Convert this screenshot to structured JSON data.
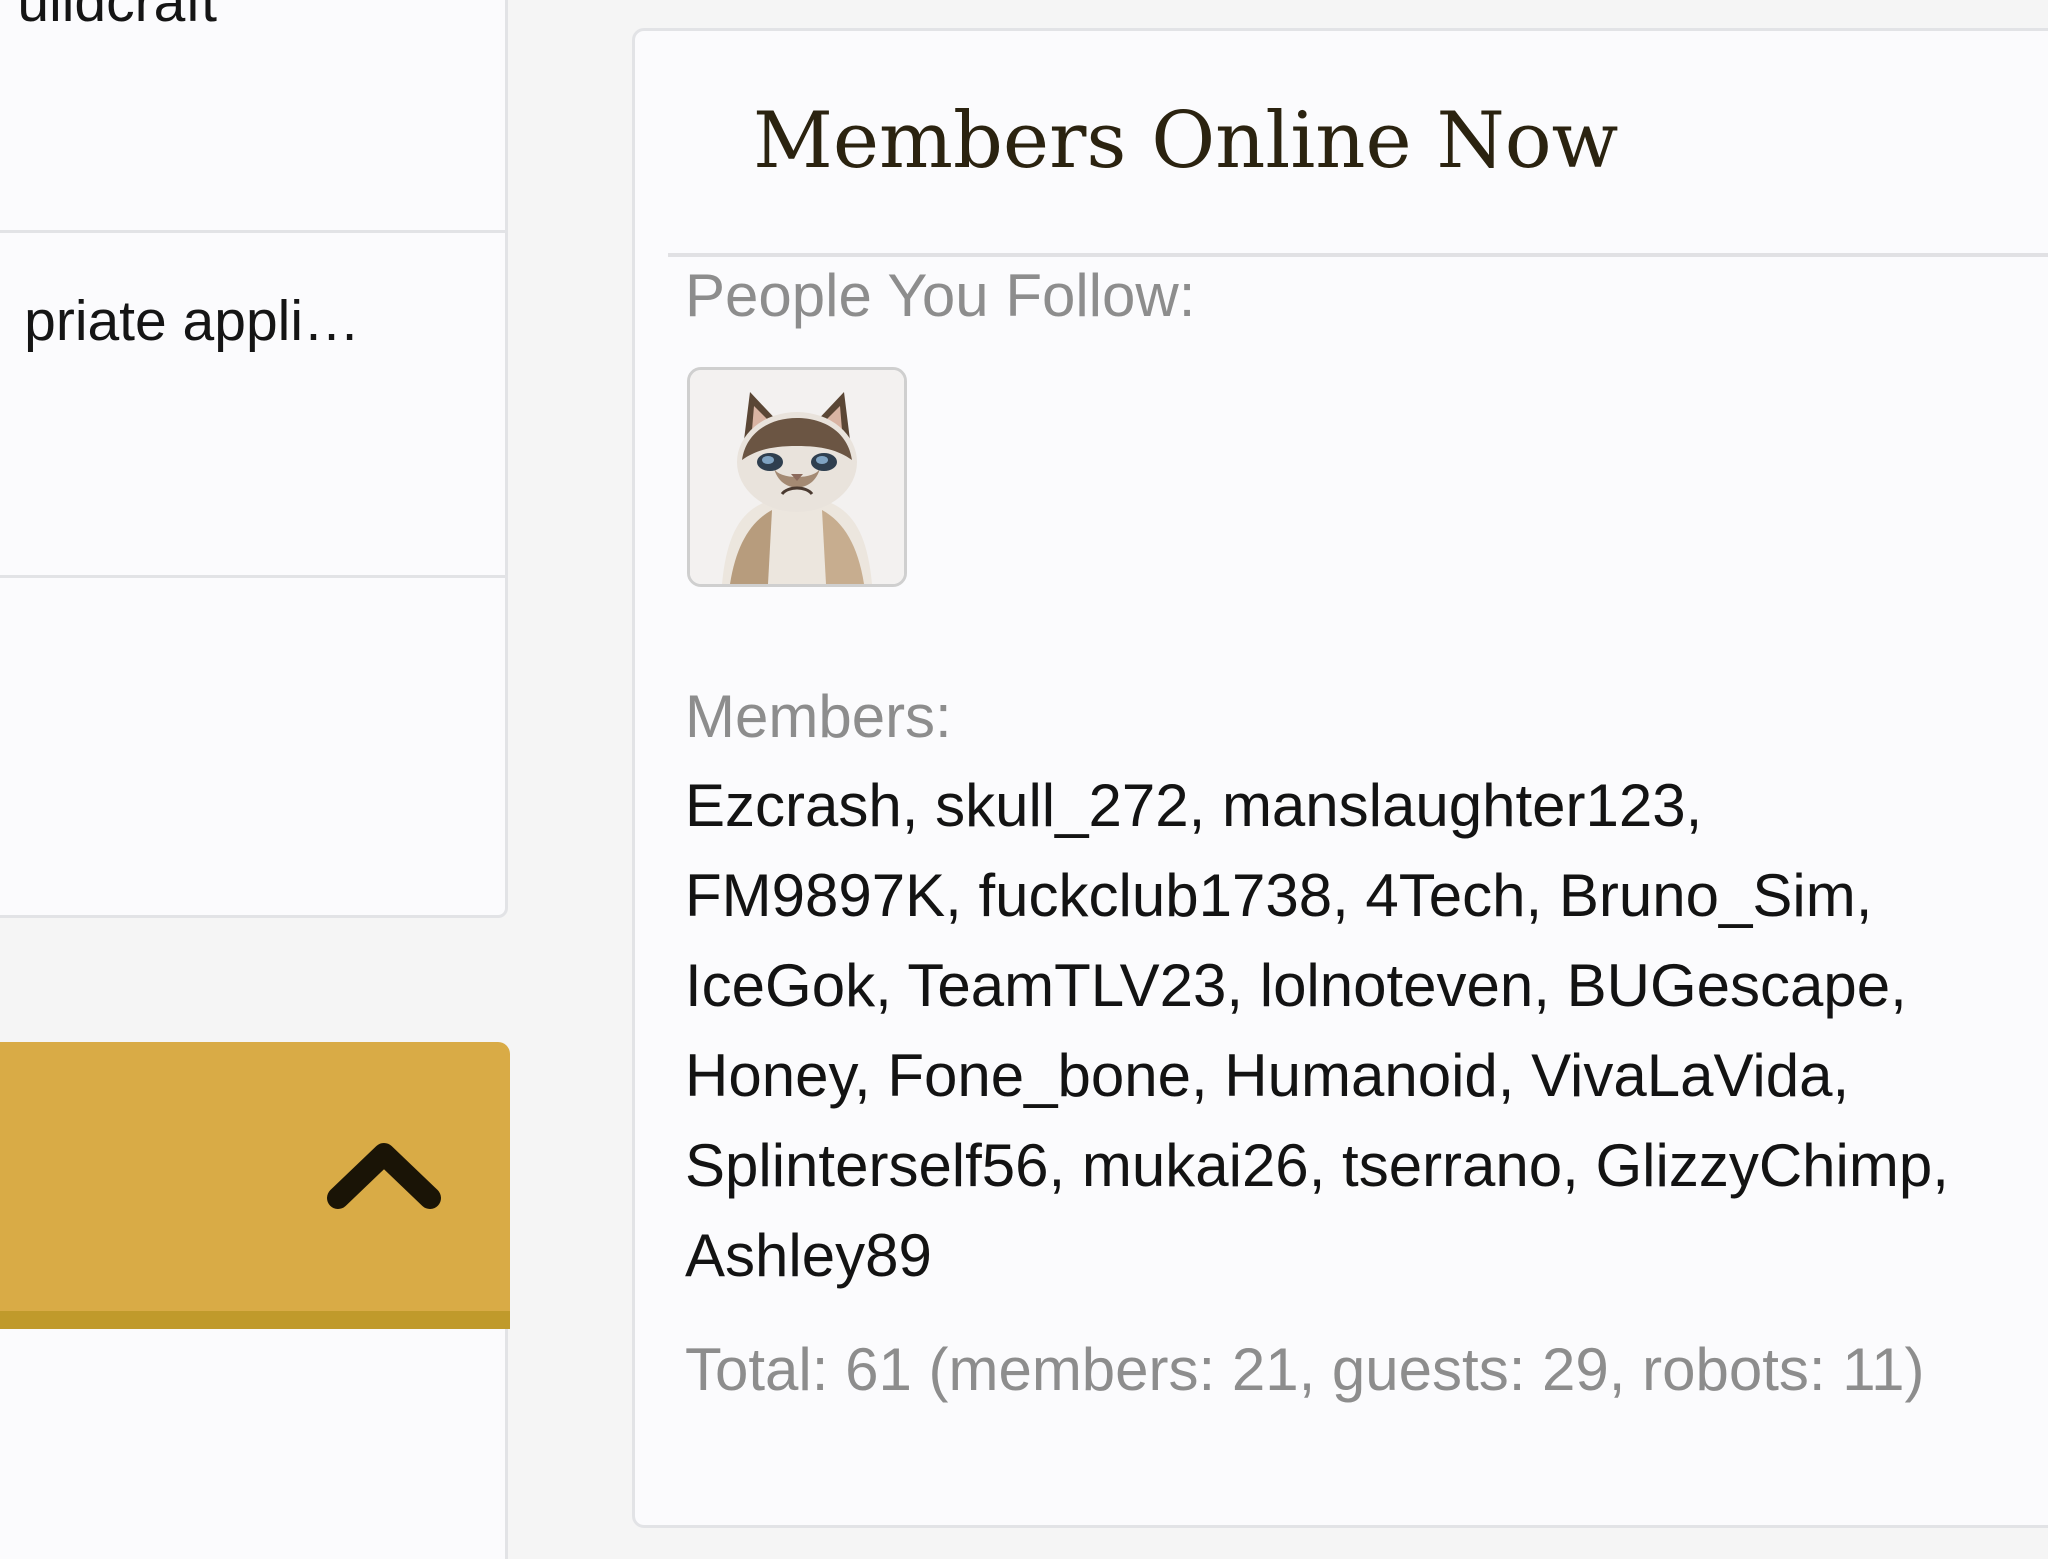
{
  "left_column": {
    "rows": [
      {
        "text": "uildcraft"
      },
      {
        "text": "priate appli…"
      }
    ],
    "collapse_icon": "chevron-up-icon",
    "collapse_color": "#d9ab46"
  },
  "members_block": {
    "title": "Members Online Now",
    "follow_label": "People You Follow:",
    "followed_avatar_icon": "grumpy-cat-avatar",
    "members_label": "Members:",
    "members": [
      "Ezcrash",
      "skull_272",
      "manslaughter123",
      "FM9897K",
      "fuckclub1738",
      "4Tech",
      "Bruno_Sim",
      "IceGok",
      "TeamTLV23",
      "lolnoteven",
      "BUGescape",
      "Honey",
      "Fone_bone",
      "Humanoid",
      "VivaLaVida",
      "Splinterself56",
      "mukai26",
      "tserrano",
      "GlizzyChimp",
      "Ashley89"
    ],
    "member_lines": [
      [
        0,
        3
      ],
      [
        3,
        7
      ],
      [
        7,
        11
      ],
      [
        11,
        15
      ],
      [
        15,
        19
      ],
      [
        19,
        20
      ]
    ],
    "total": "Total: 61 (members: 21, guests: 29, robots: 11)"
  },
  "colors": {
    "accent_gold": "#d9ab46",
    "accent_gold_dark": "#c09a2b",
    "title_color": "#2b2310",
    "muted_text": "#8d8d8d"
  }
}
